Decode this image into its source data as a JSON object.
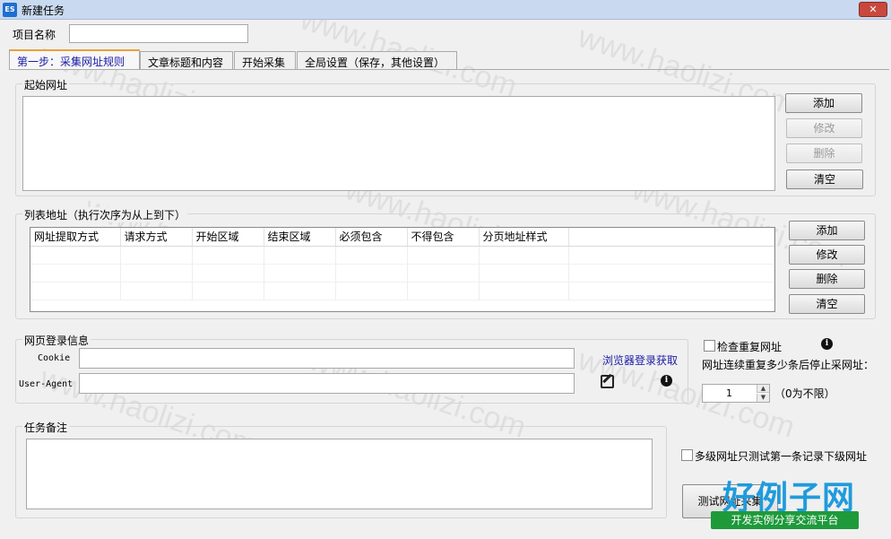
{
  "window": {
    "title": "新建任务",
    "app_badge": "ES",
    "close_glyph": "✕"
  },
  "project": {
    "label": "项目名称",
    "value": ""
  },
  "tabs": [
    {
      "label": "第一步：采集网址规则"
    },
    {
      "label": "文章标题和内容"
    },
    {
      "label": "开始采集"
    },
    {
      "label": "全局设置（保存，其他设置）"
    }
  ],
  "start_urls": {
    "title": "起始网址",
    "buttons": {
      "add": "添加",
      "edit": "修改",
      "delete": "删除",
      "clear": "清空"
    }
  },
  "list_urls": {
    "title": "列表地址（执行次序为从上到下）",
    "columns": [
      "网址提取方式",
      "请求方式",
      "开始区域",
      "结束区域",
      "必须包含",
      "不得包含",
      "分页地址样式"
    ],
    "buttons": {
      "add": "添加",
      "edit": "修改",
      "delete": "删除",
      "clear": "清空"
    }
  },
  "login": {
    "title": "网页登录信息",
    "cookie_label": "Cookie",
    "cookie_value": "",
    "ua_label": "User-Agent",
    "ua_value": "",
    "browser_link": "浏览器登录获取"
  },
  "dedupe": {
    "check_label": "检查重复网址",
    "stop_label": "网址连续重复多少条后停止采网址：",
    "stop_value": "1",
    "hint": "（0为不限）"
  },
  "notes": {
    "title": "任务备注",
    "value": ""
  },
  "multi_level": {
    "label": "多级网址只测试第一条记录下级网址"
  },
  "test_button": {
    "label": "测试网址采集"
  },
  "branding": {
    "big": "好例子网",
    "small": "开发实例分享交流平台",
    "watermark": "www.haolizi.com"
  }
}
